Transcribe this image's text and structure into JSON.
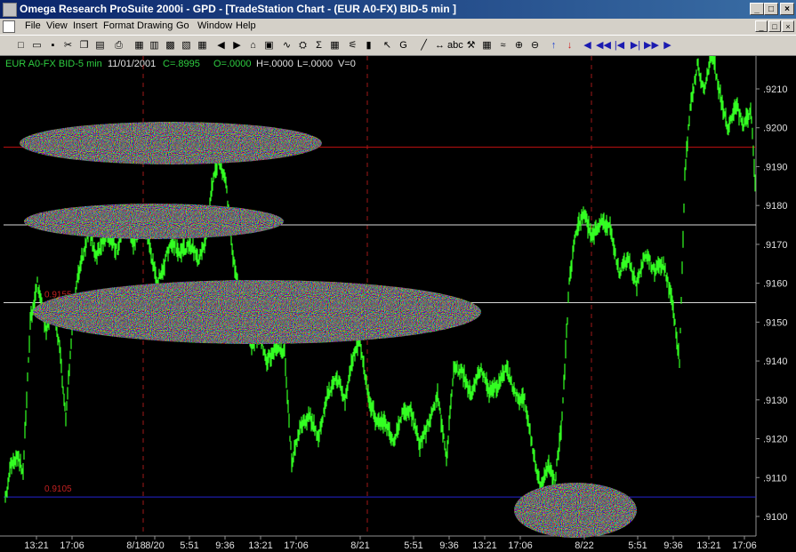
{
  "window": {
    "title": "Omega Research ProSuite 2000i - GPD - [TradeStation Chart - (EUR A0-FX)  BID-5 min ]",
    "minimize": "_",
    "maximize": "□",
    "close": "×"
  },
  "menu": {
    "items": [
      "File",
      "View",
      "Insert",
      "Format",
      "Drawing",
      "Go",
      "Window",
      "Help"
    ]
  },
  "toolbar": {
    "tools": [
      "new-icon",
      "open-icon",
      "save-icon",
      "cut-icon",
      "copy-icon",
      "paste-icon",
      "print-icon",
      "chart-window-icon",
      "page-icon",
      "grid-icon",
      "sheet-icon",
      "table-icon",
      "back-icon",
      "forward-icon",
      "home-icon",
      "arrange-icon",
      "indicator-icon",
      "strategy-icon",
      "symbol-icon",
      "grid-view-icon",
      "chart-type-icon",
      "bar-icon",
      "pointer-icon",
      "gap-icon",
      "trendline-icon",
      "horizontal-icon",
      "text-icon",
      "tools-icon",
      "calculator-icon",
      "fib-icon",
      "magnify-icon",
      "zoom-out-icon",
      "up-arrow-icon",
      "down-arrow-icon",
      "left-icon",
      "double-left-icon",
      "first-icon",
      "last-icon",
      "double-right-icon",
      "right-icon"
    ],
    "glyphs": [
      "□",
      "▭",
      "▪",
      "✂",
      "❐",
      "▤",
      "⎙",
      "▦",
      "▥",
      "▩",
      "▧",
      "▦",
      "◀",
      "▶",
      "⌂",
      "▣",
      "∿",
      "⛭",
      "Σ",
      "▦",
      "⚟",
      "▮",
      "↖",
      "G",
      "╱",
      "↔",
      "abc",
      "⚒",
      "▦",
      "≈",
      "⊕",
      "⊖",
      "↑",
      "↓",
      "◀",
      "◀◀",
      "|◀",
      "▶|",
      "▶▶",
      "▶"
    ]
  },
  "chart_header": {
    "symbol": "EUR A0-FX BID-5 min",
    "date": "11/01/2001",
    "close": "C=.8995",
    "open": "O=.0000",
    "high": "H=.0000",
    "low": "L=.0000",
    "volume": "V=0"
  },
  "price_axis": {
    "labels": [
      ".9210",
      ".9200",
      ".9190",
      ".9180",
      ".9170",
      ".9160",
      ".9150",
      ".9140",
      ".9130",
      ".9120",
      ".9110",
      ".9100"
    ]
  },
  "time_axis": {
    "labels": [
      "13:21",
      "17:06",
      "8/18",
      "8/20",
      "5:51",
      "9:36",
      "13:21",
      "17:06",
      "8/21",
      "5:51",
      "9:36",
      "13:21",
      "17:06",
      "8/22",
      "5:51",
      "9:36",
      "13:21",
      "17:06"
    ]
  },
  "levels": [
    {
      "price": ".9195",
      "label": "",
      "color": "#c41010"
    },
    {
      "price": ".9175",
      "label": "",
      "color": "#d8d8d8"
    },
    {
      "price": ".9155",
      "label": "0.9155",
      "color": "#d8d8d8"
    },
    {
      "price": ".9105",
      "label": "0.9105",
      "color": "#2424d0"
    }
  ],
  "colors": {
    "price_line": "#33ff22",
    "chart_bg": "#000000",
    "axis_text": "#e0e0e0",
    "red_line": "#c41010",
    "white_line": "#d8d8d8",
    "blue_line": "#2424d0",
    "session_divider": "#a01818"
  }
}
